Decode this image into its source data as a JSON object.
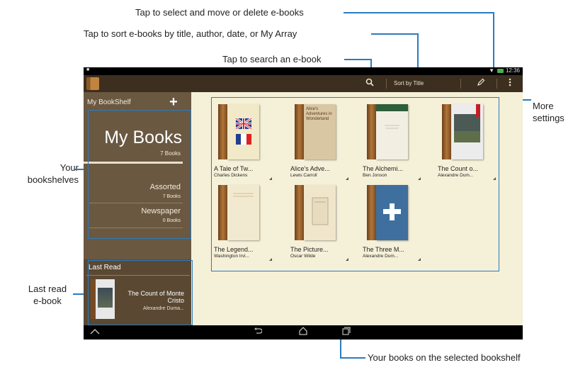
{
  "callouts": {
    "select_move_delete": "Tap to select and move or delete e-books",
    "sort": "Tap to sort e-books by title, author, date, or My Array",
    "search": "Tap to search an e-book",
    "more_settings": "More\nsettings",
    "your_bookshelves": "Your\nbookshelves",
    "last_read": "Last read\ne-book",
    "your_books": "Your books on the selected bookshelf"
  },
  "status_bar": {
    "time": "12:36"
  },
  "action_bar": {
    "search_icon": "search-icon",
    "sort_label": "Sort by Title",
    "edit_icon": "pencil-icon",
    "overflow_icon": "more-vertical-icon"
  },
  "sidebar": {
    "title": "My BookShelf",
    "add_label": "+",
    "shelves": [
      {
        "name": "My Books",
        "count": "7 Books"
      },
      {
        "name": "Assorted",
        "count": "7 Books"
      },
      {
        "name": "Newspaper",
        "count": "0 Books"
      }
    ],
    "last_read": {
      "title": "Last Read",
      "book_title": "The Count of Monte Cristo",
      "author": "Alexandre Duma..."
    }
  },
  "books": [
    {
      "title": "A Tale of Tw...",
      "author": "Charles Dickens",
      "cover_text": ""
    },
    {
      "title": "Alice's Adve...",
      "author": "Lewis Carroll",
      "cover_text": "Alice's Adventures in Wonderland"
    },
    {
      "title": "The Alchemi...",
      "author": "Ben Jonson",
      "cover_text": ""
    },
    {
      "title": "The Count o...",
      "author": "Alexandre Dum...",
      "cover_text": ""
    },
    {
      "title": "The Legend...",
      "author": "Washington Irvi...",
      "cover_text": ""
    },
    {
      "title": "The Picture...",
      "author": "Oscar Wilde",
      "cover_text": ""
    },
    {
      "title": "The Three M...",
      "author": "Alexandre Dum...",
      "cover_text": ""
    }
  ],
  "colors": {
    "callout_line": "#2b7bbf",
    "action_bar": "#3d2f1f",
    "sidebar": "#6a5841",
    "shelf_bg": "#f5f0d8"
  }
}
